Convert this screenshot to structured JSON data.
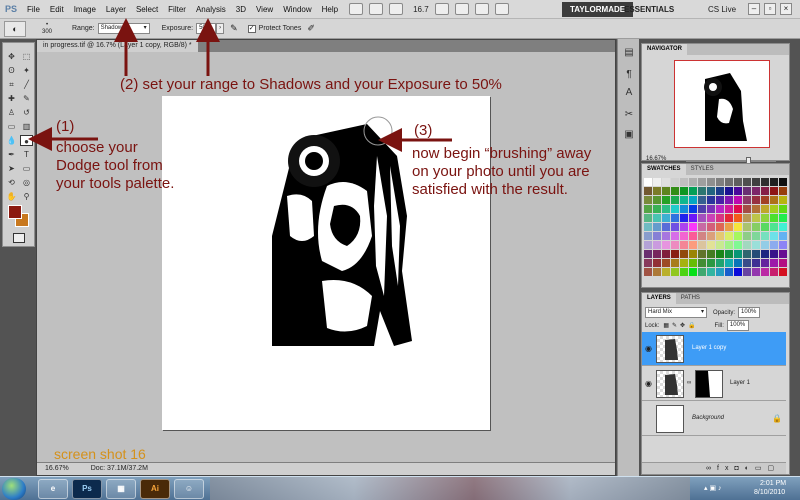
{
  "app": {
    "logo": "PS"
  },
  "menu": [
    "File",
    "Edit",
    "Image",
    "Layer",
    "Select",
    "Filter",
    "Analysis",
    "3D",
    "View",
    "Window",
    "Help"
  ],
  "menubar": {
    "zoom": "16.7",
    "workspaces": [
      "TAYLORMADE",
      "ESSENTIALS"
    ],
    "cs_live": "CS Live"
  },
  "options": {
    "brush_size": "300",
    "range_label": "Range:",
    "range_value": "Shadows",
    "exposure_label": "Exposure:",
    "exposure_value": "50%",
    "protect_tones_label": "Protect Tones",
    "protect_tones_checked": true
  },
  "document": {
    "tab_title": "in progress.tif @ 16.7% (Layer 1 copy, RGB/8) *",
    "status_zoom": "16.67%",
    "status_doc": "Doc: 37.1M/37.2M"
  },
  "annotations": {
    "step1_num": "(1)",
    "step1_text": [
      "choose your",
      "Dodge tool from",
      "your tools palette."
    ],
    "step2_text": "(2) set your range to Shadows and your Exposure to 50%",
    "step3_num": "(3)",
    "step3_text": [
      "now begin “brushing” away",
      "on your photo until you are",
      "satisfied with the result."
    ],
    "watermark": "screen shot 16"
  },
  "navigator": {
    "tab": "NAVIGATOR",
    "zoom": "16.67%"
  },
  "swatches": {
    "tabs": [
      "SWATCHES",
      "STYLES"
    ]
  },
  "layers": {
    "tabs": [
      "LAYERS",
      "PATHS"
    ],
    "blend_mode": "Hard Mix",
    "opacity_label": "Opacity:",
    "opacity": "100%",
    "lock_label": "Lock:",
    "fill_label": "Fill:",
    "fill": "100%",
    "items": [
      {
        "name": "Layer 1 copy",
        "active": true
      },
      {
        "name": "Layer 1",
        "active": false
      },
      {
        "name": "Background",
        "active": false
      }
    ]
  },
  "taskbar": {
    "apps": [
      "Ps",
      "Ai"
    ],
    "time": "2:01 PM",
    "date": "8/10/2010"
  }
}
